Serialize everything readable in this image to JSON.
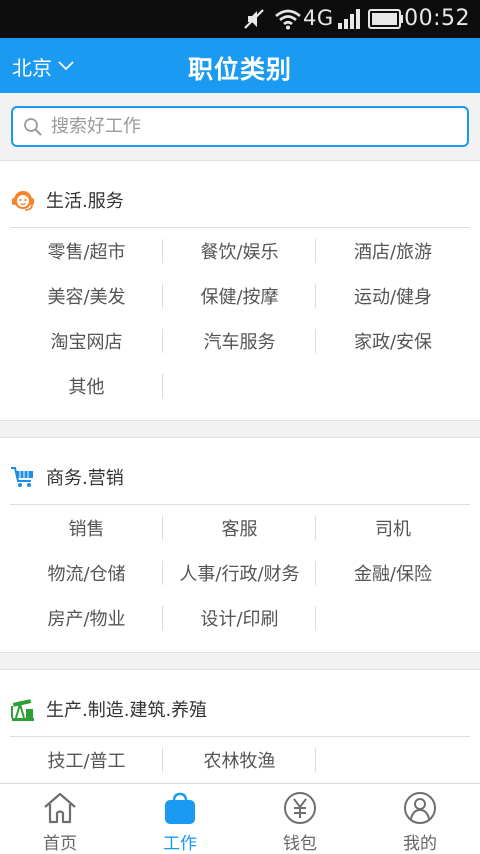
{
  "status_bar": {
    "network": "4G",
    "time": "00:52"
  },
  "header": {
    "city": "北京",
    "title": "职位类别"
  },
  "search": {
    "placeholder": "搜索好工作"
  },
  "colors": {
    "accent": "#1a9af0",
    "status_bar_bg": "#0d0d0d",
    "icon_orange": "#f5832a",
    "icon_blue": "#1e8de8",
    "icon_green": "#2e9e36"
  },
  "sections": [
    {
      "icon": "customer-service-icon",
      "title": "生活.服务",
      "items": [
        "零售/超市",
        "餐饮/娱乐",
        "酒店/旅游",
        "美容/美发",
        "保健/按摩",
        "运动/健身",
        "淘宝网店",
        "汽车服务",
        "家政/安保",
        "其他"
      ]
    },
    {
      "icon": "shopping-cart-icon",
      "title": "商务.营销",
      "items": [
        "销售",
        "客服",
        "司机",
        "物流/仓储",
        "人事/行政/财务",
        "金融/保险",
        "房产/物业",
        "设计/印刷"
      ]
    },
    {
      "icon": "oil-pump-icon",
      "title": "生产.制造.建筑.养殖",
      "items": [
        "技工/普工",
        "农林牧渔"
      ]
    }
  ],
  "tabs": [
    {
      "icon": "home-icon",
      "label": "首页",
      "active": false
    },
    {
      "icon": "briefcase-icon",
      "label": "工作",
      "active": true
    },
    {
      "icon": "wallet-yuan-icon",
      "label": "钱包",
      "active": false
    },
    {
      "icon": "user-icon",
      "label": "我的",
      "active": false
    }
  ]
}
